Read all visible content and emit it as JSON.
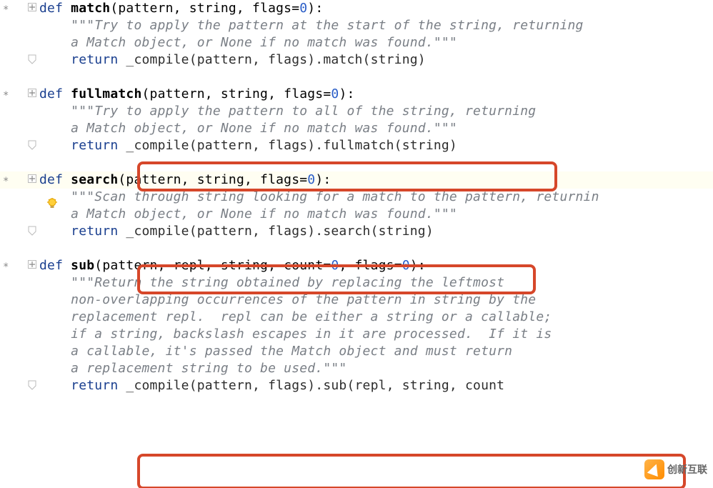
{
  "watermark": "创新互联",
  "code": {
    "match": {
      "sig_pre": "def ",
      "name": "match",
      "params": "(pattern, string, flags=",
      "default": "0",
      "close": "):",
      "doc1": "\"\"\"Try to apply the pattern at the start of the string, returning",
      "doc2": "a Match object, or None if no match was found.\"\"\"",
      "ret": "return ",
      "call": "_compile(pattern, flags).match(string)"
    },
    "fullmatch": {
      "sig_pre": "def ",
      "name": "fullmatch",
      "params": "(pattern, string, flags=",
      "default": "0",
      "close": "):",
      "doc1": "\"\"\"Try to apply the pattern to all of the string, returning",
      "doc2": "a Match object, or None if no match was found.\"\"\"",
      "ret": "return ",
      "call": "_compile(pattern, flags).fullmatch(string)"
    },
    "search": {
      "sig_pre": "def ",
      "name": "search",
      "params": "(pattern, string, flags=",
      "default": "0",
      "close": "):",
      "doc1": "\"\"\"Scan through string looking for a match to the pattern, returnin",
      "doc2": "a Match object, or None if no match was found.\"\"\"",
      "ret": "return ",
      "call": "_compile(pattern, flags).search(string)"
    },
    "sub": {
      "sig_pre": "def ",
      "name": "sub",
      "params": "(pattern, repl, string, count=",
      "default0": "0",
      "mid": ", flags=",
      "default1": "0",
      "close": "):",
      "doc1": "\"\"\"Return the string obtained by replacing the leftmost",
      "doc2": "non-overlapping occurrences of the pattern in string by the",
      "doc3": "replacement repl.  repl can be either a string or a callable;",
      "doc4": "if a string, backslash escapes in it are processed.  If it is",
      "doc5": "a callable, it's passed the Match object and must return",
      "doc6": "a replacement string to be used.\"\"\"",
      "ret": "return ",
      "call": "_compile(pattern, flags).sub(repl, string, count"
    }
  }
}
